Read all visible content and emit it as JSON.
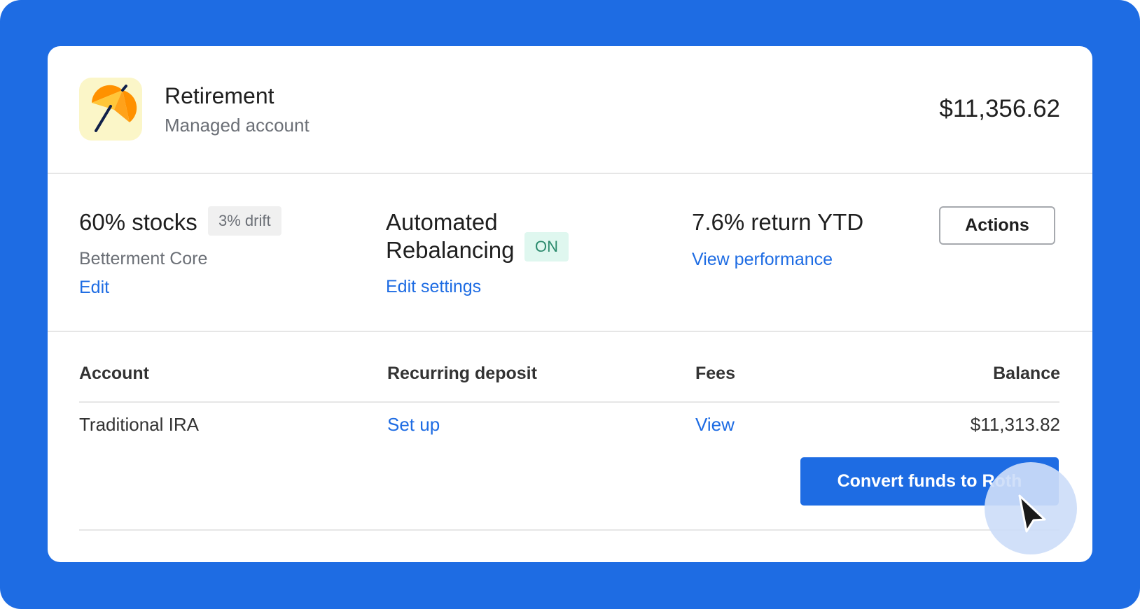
{
  "colors": {
    "accent": "#1e6ce3",
    "on_badge_bg": "#dff7ef",
    "on_badge_text": "#2b8a6d",
    "drift_badge_bg": "#f0f0f0",
    "logo_tile_bg": "#fbf6c8"
  },
  "account": {
    "icon": "umbrella-icon",
    "title": "Retirement",
    "subtitle": "Managed account",
    "total_balance": "$11,356.62"
  },
  "summary": {
    "allocation_label": "60% stocks",
    "drift_badge": "3% drift",
    "portfolio_name": "Betterment Core",
    "edit_link": "Edit",
    "rebalancing_label": "Automated Rebalancing",
    "rebalancing_status": "ON",
    "edit_settings_link": "Edit settings",
    "return_label": "7.6% return YTD",
    "view_performance_link": "View performance",
    "actions_button": "Actions"
  },
  "table": {
    "headers": [
      "Account",
      "Recurring deposit",
      "Fees",
      "Balance"
    ],
    "rows": [
      {
        "account": "Traditional IRA",
        "recurring_deposit": "Set up",
        "fees": "View",
        "balance": "$11,313.82"
      }
    ]
  },
  "convert_button": "Convert funds to Roth",
  "cursor_icon": "pointer-cursor-icon"
}
